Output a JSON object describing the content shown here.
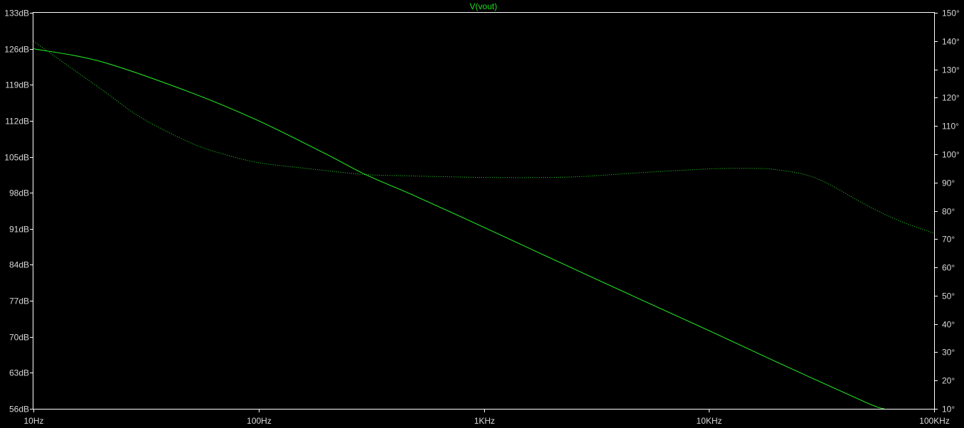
{
  "window": {
    "title": "V(vout)"
  },
  "colors": {
    "background": "#000000",
    "frame": "#ffffff",
    "tick_text": "#d8d8d8",
    "trace": "#22dd22",
    "title": "#22dd22"
  },
  "chart_data": {
    "type": "line",
    "title": "V(vout)",
    "x_scale": "log",
    "xlim": [
      10,
      100000
    ],
    "x_tick_values": [
      10,
      100,
      1000,
      10000,
      100000
    ],
    "x_tick_labels": [
      "10Hz",
      "100Hz",
      "1KHz",
      "10KHz",
      "100KHz"
    ],
    "y_left": {
      "ylim": [
        56,
        133
      ],
      "tick_values": [
        133,
        126,
        119,
        112,
        105,
        98,
        91,
        84,
        77,
        70,
        63,
        56
      ],
      "tick_labels": [
        "133dB",
        "126dB",
        "119dB",
        "112dB",
        "105dB",
        "98dB",
        "91dB",
        "84dB",
        "77dB",
        "70dB",
        "63dB",
        "56dB"
      ]
    },
    "y_right": {
      "ylim": [
        10,
        150
      ],
      "tick_values": [
        150,
        140,
        130,
        120,
        110,
        100,
        90,
        80,
        70,
        60,
        50,
        40,
        30,
        20,
        10
      ],
      "tick_labels": [
        "150°",
        "140°",
        "130°",
        "120°",
        "110°",
        "100°",
        "90°",
        "80°",
        "70°",
        "60°",
        "50°",
        "40°",
        "30°",
        "20°",
        "10°"
      ]
    },
    "grid": false,
    "series": [
      {
        "axis": "left",
        "style": "solid",
        "x": [
          10,
          20,
          50,
          100,
          200,
          300,
          500,
          1000,
          2000,
          5000,
          10000,
          20000,
          50000,
          60000
        ],
        "values": [
          126,
          123.5,
          117.5,
          112,
          105.5,
          101.5,
          97.3,
          91.3,
          85.2,
          77.2,
          71.2,
          65.1,
          57.2,
          56
        ]
      },
      {
        "axis": "right",
        "style": "dotted",
        "x": [
          10,
          15,
          20,
          30,
          50,
          70,
          100,
          150,
          200,
          300,
          500,
          1000,
          2000,
          3000,
          5000,
          10000,
          15000,
          20000,
          30000,
          50000,
          70000,
          100000
        ],
        "values": [
          140,
          130,
          123,
          113,
          104,
          100,
          97,
          95.3,
          94.2,
          92.8,
          92.3,
          91.8,
          91.8,
          92.3,
          93.5,
          94.8,
          95,
          94.5,
          91.5,
          82,
          76.5,
          72
        ]
      }
    ]
  }
}
